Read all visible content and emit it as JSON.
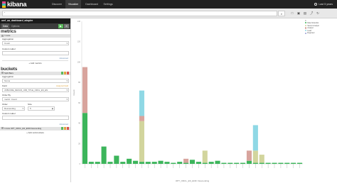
{
  "app": {
    "name": "kibana"
  },
  "nav": {
    "tabs": [
      {
        "label": "Discover"
      },
      {
        "label": "Visualize"
      },
      {
        "label": "Dashboard"
      },
      {
        "label": "Settings"
      }
    ],
    "time_label": "Last 5 years"
  },
  "search": {
    "value": "*"
  },
  "sidebar": {
    "index_name": "oref_ua_dashboard_adapter",
    "tabs": [
      {
        "label": "Data"
      },
      {
        "label": "Options"
      }
    ],
    "metrics_title": "metrics",
    "y_axis_label": "Y-Axis",
    "aggregation_label": "Aggregation",
    "aggregation_value": "Count",
    "custom_label": "Custom Label",
    "advanced": "Advanced",
    "add_metrics": "Add metrics",
    "buckets_title": "buckets",
    "split_bars_label": "Split Bars",
    "agg2_label": "Aggregation",
    "agg2_value": "Terms",
    "field_label": "Field",
    "field_value": "JOBCODE_DESCR_JOB_TITLE_ORCL_ES_EN",
    "analyzed_field": "Analyzed Field",
    "order_by_label": "Order By",
    "order_by_value": "metric: Count",
    "order_label": "Order",
    "order_value": "Descending",
    "size_label": "Size",
    "size_value": "5",
    "custom_label2": "Custom Label",
    "advanced2": "Advanced",
    "xaxis_row": "X-Axis  OPT_ORCL_ES_END Descending",
    "add_sub_buckets": "Add sub-buckets"
  },
  "chart_data": {
    "type": "bar",
    "stacked": true,
    "ylabel": "Count",
    "xlabel": "OPT_ORCL_ES_END: Descending",
    "colors": [
      "#3cb55b",
      "#d2d59d",
      "#d8a49d",
      "#8fd8e5",
      "#9b9fd4"
    ],
    "series": [
      {
        "name": "Data Scientist",
        "values": [
          50,
          2,
          2,
          17,
          2,
          8,
          2,
          5,
          3,
          2,
          2,
          2,
          3,
          2,
          1,
          2,
          1,
          4,
          2,
          1,
          2,
          3,
          1,
          1,
          1,
          1,
          3,
          1,
          1,
          1,
          1,
          1,
          1,
          1,
          1
        ]
      },
      {
        "name": "Senior Analyst",
        "values": [
          0,
          0,
          0,
          0,
          0,
          0,
          0,
          0,
          0,
          40,
          0,
          0,
          0,
          0,
          0,
          0,
          0,
          0,
          0,
          12,
          0,
          0,
          0,
          0,
          0,
          0,
          0,
          12,
          8,
          0,
          0,
          0,
          0,
          0,
          0
        ]
      },
      {
        "name": "Analyst",
        "values": [
          45,
          0,
          0,
          0,
          0,
          0,
          0,
          0,
          0,
          5,
          0,
          0,
          0,
          0,
          0,
          0,
          4,
          0,
          0,
          0,
          0,
          0,
          0,
          0,
          0,
          0,
          10,
          0,
          0,
          0,
          0,
          0,
          0,
          0,
          0
        ]
      },
      {
        "name": "Lead",
        "values": [
          0,
          0,
          0,
          0,
          0,
          0,
          0,
          0,
          0,
          25,
          0,
          0,
          0,
          0,
          0,
          0,
          0,
          0,
          0,
          0,
          0,
          0,
          0,
          0,
          0,
          0,
          0,
          25,
          0,
          0,
          0,
          0,
          0,
          0,
          0
        ]
      },
      {
        "name": "Engineer",
        "values": [
          0,
          0,
          0,
          0,
          0,
          0,
          0,
          0,
          0,
          0,
          0,
          0,
          0,
          0,
          0,
          0,
          0,
          0,
          0,
          0,
          0,
          0,
          0,
          0,
          0,
          0,
          0,
          0,
          0,
          0,
          0,
          0,
          0,
          0,
          0
        ]
      }
    ],
    "ylim": [
      0,
      140
    ],
    "grid": false,
    "legend_placement": "top-right"
  },
  "legend": {
    "items": [
      {
        "label": "Data Scientist",
        "color": "#3cb55b"
      },
      {
        "label": "Senior Analyst",
        "color": "#d2d59d"
      },
      {
        "label": "Analyst",
        "color": "#d8a49d"
      },
      {
        "label": "Lead",
        "color": "#8fd8e5"
      },
      {
        "label": "Engineer",
        "color": "#9b9fd4"
      }
    ]
  }
}
